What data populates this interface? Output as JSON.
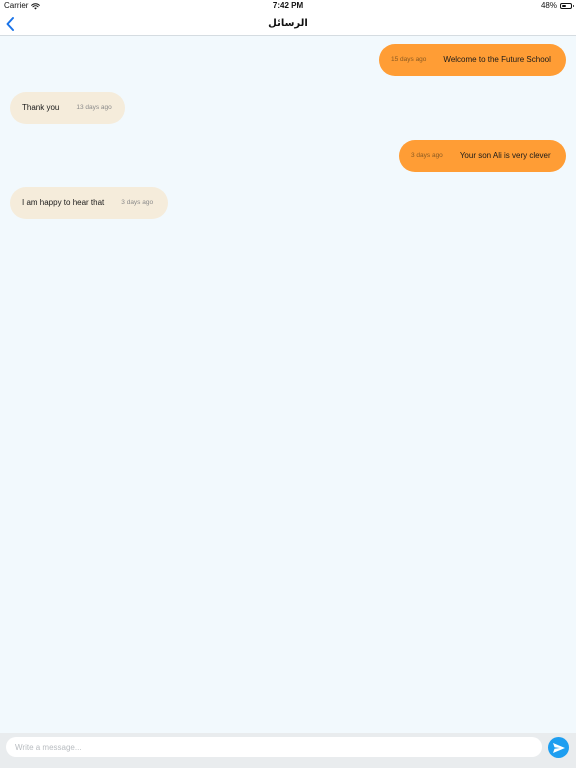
{
  "status_bar": {
    "carrier": "Carrier",
    "time": "7:42 PM",
    "battery_percent": "48%",
    "battery_level": 0.48
  },
  "nav": {
    "title": "الرسائل"
  },
  "messages": [
    {
      "direction": "sent",
      "text": "Welcome to the Future School",
      "time": "15 days ago"
    },
    {
      "direction": "received",
      "text": "Thank you",
      "time": "13 days ago"
    },
    {
      "direction": "sent",
      "text": "Your son Ali is very clever",
      "time": "3 days ago"
    },
    {
      "direction": "received",
      "text": "I am happy to hear that",
      "time": "3 days ago"
    }
  ],
  "composer": {
    "placeholder": "Write a message..."
  },
  "colors": {
    "sent_bubble": "#ff9d35",
    "received_bubble": "#f5ecdb",
    "accent": "#1e9ef0",
    "background": "#f2f9fd"
  }
}
